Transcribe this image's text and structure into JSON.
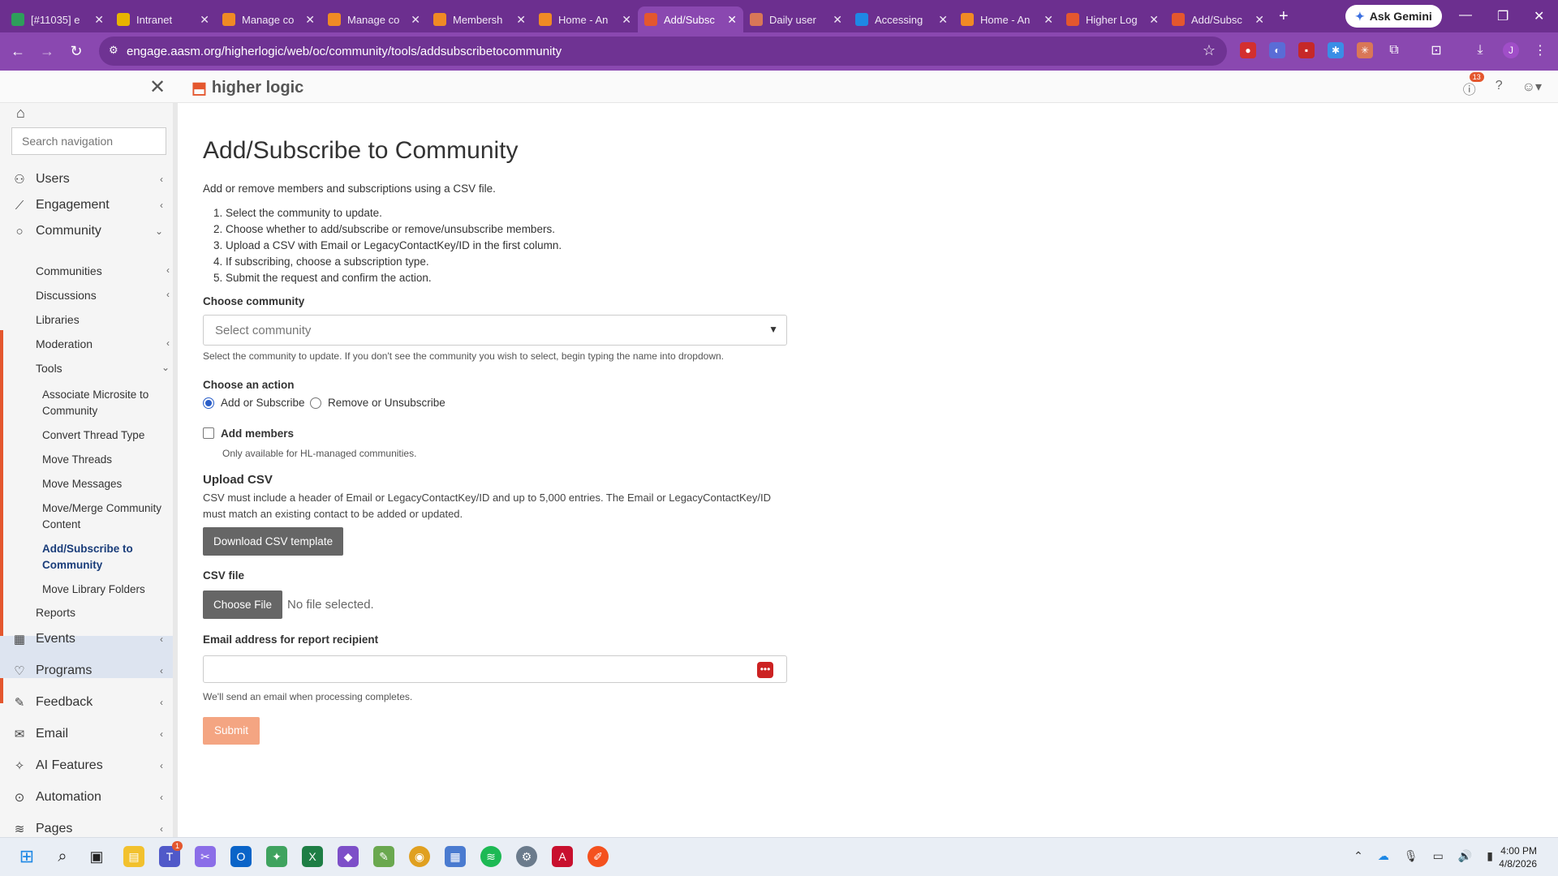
{
  "browser": {
    "tabs": [
      {
        "title": "[#11035] e",
        "icon": "ticket-icon",
        "color": "#2e9e5b"
      },
      {
        "title": "Intranet",
        "icon": "intranet-icon",
        "color": "#e8b400"
      },
      {
        "title": "Manage co",
        "icon": "app-icon",
        "color": "#f08a24"
      },
      {
        "title": "Manage co",
        "icon": "app-icon",
        "color": "#f08a24"
      },
      {
        "title": "Membersh",
        "icon": "app-icon",
        "color": "#f08a24"
      },
      {
        "title": "Home - An",
        "icon": "app-icon",
        "color": "#f08a24"
      },
      {
        "title": "Add/Subsc",
        "icon": "higherlogic-icon",
        "color": "#e4572e"
      },
      {
        "title": "Daily user",
        "icon": "claude-icon",
        "color": "#d97757"
      },
      {
        "title": "Accessing",
        "icon": "info-icon",
        "color": "#1e88e5"
      },
      {
        "title": "Home - An",
        "icon": "app-icon",
        "color": "#f08a24"
      },
      {
        "title": "Higher Log",
        "icon": "higherlogic-icon",
        "color": "#e4572e"
      },
      {
        "title": "Add/Subsc",
        "icon": "higherlogic-icon",
        "color": "#e4572e"
      }
    ],
    "active_tab": 6,
    "ask_gemini": "Ask Gemini",
    "url": "engage.aasm.org/higherlogic/web/oc/community/tools/addsubscribetocommunity"
  },
  "header": {
    "logo_text": "higher logic",
    "notification_count": "13"
  },
  "sidebar": {
    "search_placeholder": "Search navigation",
    "top_items": [
      {
        "label": "Users",
        "icon": "users-icon"
      },
      {
        "label": "Engagement",
        "icon": "chart-icon"
      },
      {
        "label": "Community",
        "icon": "circle-icon"
      }
    ],
    "community_children": [
      "Communities",
      "Discussions",
      "Libraries",
      "Moderation",
      "Tools"
    ],
    "tools_children": [
      "Associate Microsite to Community",
      "Convert Thread Type",
      "Move Threads",
      "Move Messages",
      "Move/Merge Community Content",
      "Add/Subscribe to Community",
      "Move Library Folders"
    ],
    "reports": "Reports",
    "bottom_items": [
      {
        "label": "Events",
        "icon": "calendar-icon"
      },
      {
        "label": "Programs",
        "icon": "heart-icon"
      },
      {
        "label": "Feedback",
        "icon": "edit-icon"
      },
      {
        "label": "Email",
        "icon": "mail-icon"
      },
      {
        "label": "AI Features",
        "icon": "sparkle-icon"
      },
      {
        "label": "Automation",
        "icon": "robot-icon"
      },
      {
        "label": "Pages",
        "icon": "layers-icon"
      }
    ]
  },
  "main": {
    "title": "Add/Subscribe to Community",
    "intro": "Add or remove members and subscriptions using a CSV file.",
    "steps": [
      "Select the community to update.",
      "Choose whether to add/subscribe or remove/unsubscribe members.",
      "Upload a CSV with Email or LegacyContactKey/ID in the first column.",
      "If subscribing, choose a subscription type.",
      "Submit the request and confirm the action."
    ],
    "choose_community_label": "Choose community",
    "select_placeholder": "Select community",
    "select_help": "Select the community to update. If you don't see the community you wish to select, begin typing the name into dropdown.",
    "choose_action_label": "Choose an action",
    "action_add": "Add or Subscribe",
    "action_remove": "Remove or Unsubscribe",
    "add_members_label": "Add members",
    "add_members_help": "Only available for HL-managed communities.",
    "upload_heading": "Upload CSV",
    "upload_text": "CSV must include a header of Email or LegacyContactKey/ID and up to 5,000 entries. The Email or LegacyContactKey/ID must match an existing contact to be added or updated.",
    "download_button": "Download CSV template",
    "csv_file_label": "CSV file",
    "choose_file_button": "Choose File",
    "no_file_text": "No file selected.",
    "email_label": "Email address for report recipient",
    "email_help": "We'll send an email when processing completes.",
    "submit_button": "Submit"
  },
  "taskbar": {
    "time": "4:00 PM",
    "date": "4/8/2026",
    "teams_badge": "1"
  }
}
